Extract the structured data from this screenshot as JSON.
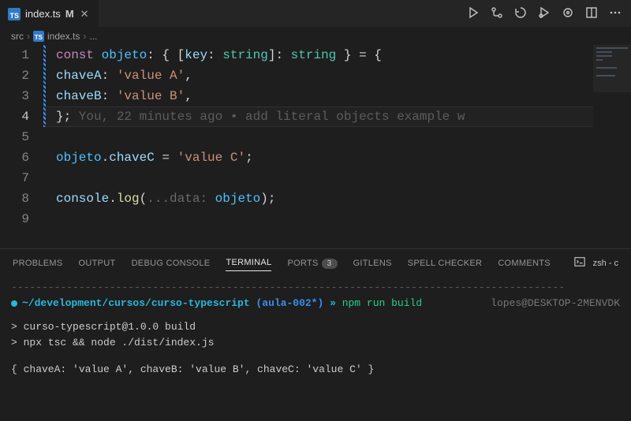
{
  "tab": {
    "filename": "index.ts",
    "modified_marker": "M",
    "icon": "TS"
  },
  "editor_actions": [
    "play",
    "compare",
    "timeline",
    "run-debug",
    "gitlens",
    "split",
    "more"
  ],
  "breadcrumbs": {
    "folder": "src",
    "file": "index.ts",
    "more": "..."
  },
  "code": {
    "lines": [
      {
        "n": 1,
        "tokens": [
          [
            "kw",
            "const "
          ],
          [
            "id",
            "objeto"
          ],
          [
            "punc",
            ": { ["
          ],
          [
            "prop",
            "key"
          ],
          [
            "punc",
            ": "
          ],
          [
            "type",
            "string"
          ],
          [
            "punc",
            "]: "
          ],
          [
            "type",
            "string"
          ],
          [
            "punc",
            " } = {"
          ]
        ]
      },
      {
        "n": 2,
        "tokens": [
          [
            "punc",
            "  "
          ],
          [
            "prop",
            "chaveA"
          ],
          [
            "punc",
            ": "
          ],
          [
            "str",
            "'value A'"
          ],
          [
            "punc",
            ","
          ]
        ]
      },
      {
        "n": 3,
        "tokens": [
          [
            "punc",
            "  "
          ],
          [
            "prop",
            "chaveB"
          ],
          [
            "punc",
            ": "
          ],
          [
            "str",
            "'value B'"
          ],
          [
            "punc",
            ","
          ]
        ]
      },
      {
        "n": 4,
        "tokens": [
          [
            "punc",
            "};"
          ]
        ],
        "current": true,
        "blame": "     You, 22 minutes ago • add literal objects example w"
      },
      {
        "n": 5,
        "tokens": []
      },
      {
        "n": 6,
        "tokens": [
          [
            "id",
            "objeto"
          ],
          [
            "punc",
            "."
          ],
          [
            "prop",
            "chaveC"
          ],
          [
            "punc",
            " = "
          ],
          [
            "str",
            "'value C'"
          ],
          [
            "punc",
            ";"
          ]
        ]
      },
      {
        "n": 7,
        "tokens": []
      },
      {
        "n": 8,
        "tokens": [
          [
            "obj",
            "console"
          ],
          [
            "punc",
            "."
          ],
          [
            "fn",
            "log"
          ],
          [
            "punc",
            "("
          ],
          [
            "hint",
            "...data: "
          ],
          [
            "id",
            "objeto"
          ],
          [
            "punc",
            ");"
          ]
        ]
      },
      {
        "n": 9,
        "tokens": []
      }
    ]
  },
  "panel": {
    "tabs": [
      "PROBLEMS",
      "OUTPUT",
      "DEBUG CONSOLE",
      "TERMINAL",
      "PORTS",
      "GITLENS",
      "SPELL CHECKER",
      "COMMENTS"
    ],
    "ports_badge": "3",
    "terminal_label": "zsh - c"
  },
  "terminal": {
    "dashline": "------------------------------------------------------------------------------------------",
    "prompt_path": "~/development/cursos/curso-typescript",
    "prompt_branch": "(aula-002*)",
    "prompt_sep": " » ",
    "command": "npm run build",
    "host": "lopes@DESKTOP-2MENVDK",
    "out1": "> curso-typescript@1.0.0 build",
    "out2": "> npx tsc && node ./dist/index.js",
    "result": "{ chaveA: 'value A', chaveB: 'value B', chaveC: 'value C' }"
  }
}
